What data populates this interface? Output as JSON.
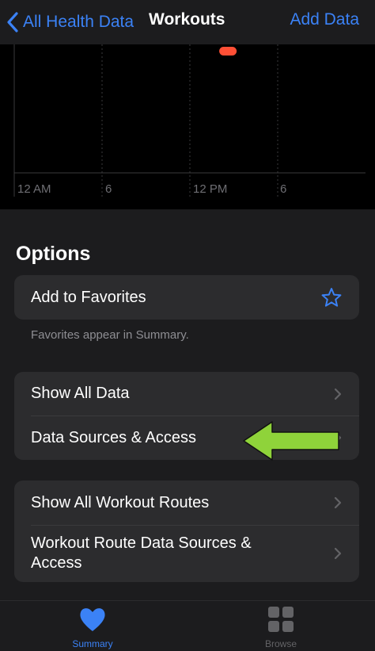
{
  "nav": {
    "back_label": "All Health Data",
    "title": "Workouts",
    "action_label": "Add Data"
  },
  "chart_data": {
    "type": "scatter",
    "x_ticks": [
      "12 AM",
      "6",
      "12 PM",
      "6"
    ],
    "points": [
      {
        "x_hour": 14.6,
        "label": "workout"
      }
    ],
    "accent_color": "#ff4f35"
  },
  "options": {
    "title": "Options",
    "favorites_label": "Add to Favorites",
    "favorites_note": "Favorites appear in Summary.",
    "group1": [
      "Show All Data",
      "Data Sources & Access"
    ],
    "group2": [
      "Show All Workout Routes",
      "Workout Route Data Sources & Access"
    ]
  },
  "tabs": {
    "summary": "Summary",
    "browse": "Browse"
  },
  "colors": {
    "accent": "#3b82f6",
    "annotation_arrow": "#8fd33a"
  }
}
